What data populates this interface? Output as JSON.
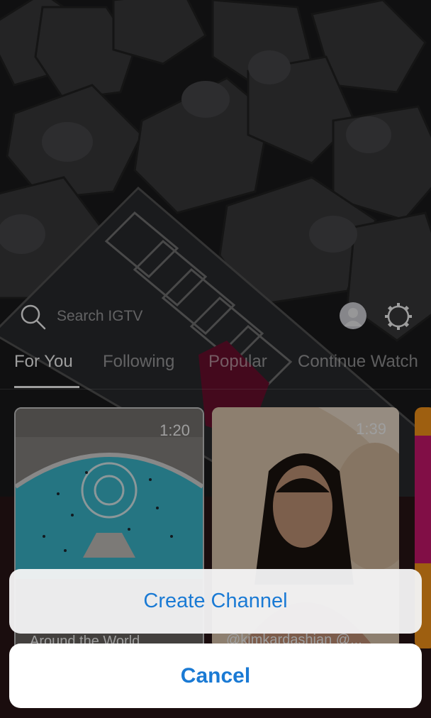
{
  "header": {
    "search_placeholder": "Search IGTV",
    "search_icon": "search-icon",
    "profile_icon": "profile-avatar-icon",
    "settings_icon": "gear-icon"
  },
  "tabs": [
    {
      "label": "For You",
      "active": true
    },
    {
      "label": "Following",
      "active": false
    },
    {
      "label": "Popular",
      "active": false
    },
    {
      "label": "Continue Watch",
      "active": false
    }
  ],
  "videos": [
    {
      "duration": "1:20",
      "caption": "Around the World..."
    },
    {
      "duration": "1:39",
      "caption": "@kimkardashian @..."
    }
  ],
  "action_sheet": {
    "create_label": "Create Channel",
    "cancel_label": "Cancel"
  },
  "colors": {
    "accent": "#1a7ad4",
    "sheet_bg": "#f2f2f4"
  }
}
